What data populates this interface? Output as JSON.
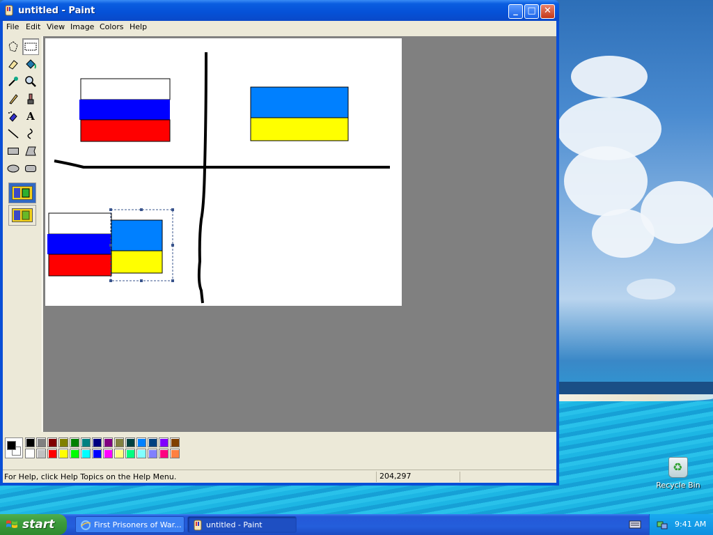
{
  "window": {
    "title": "untitled - Paint",
    "controls": {
      "minimize": "_",
      "maximize": "□",
      "close": "✕"
    }
  },
  "menu": [
    "File",
    "Edit",
    "View",
    "Image",
    "Colors",
    "Help"
  ],
  "tools": [
    {
      "name": "free-form-select-icon"
    },
    {
      "name": "select-icon",
      "active": true
    },
    {
      "name": "eraser-icon"
    },
    {
      "name": "fill-icon"
    },
    {
      "name": "pick-color-icon"
    },
    {
      "name": "magnifier-icon"
    },
    {
      "name": "pencil-icon"
    },
    {
      "name": "brush-icon"
    },
    {
      "name": "airbrush-icon"
    },
    {
      "name": "text-icon",
      "glyph": "A"
    },
    {
      "name": "line-icon"
    },
    {
      "name": "curve-icon"
    },
    {
      "name": "rectangle-icon"
    },
    {
      "name": "polygon-icon"
    },
    {
      "name": "ellipse-icon"
    },
    {
      "name": "rounded-rectangle-icon"
    }
  ],
  "palette": {
    "foreground": "#000000",
    "background": "#ffffff",
    "top_row": [
      "#000000",
      "#808080",
      "#800000",
      "#808000",
      "#008000",
      "#008080",
      "#000080",
      "#800080",
      "#808040",
      "#004040",
      "#0080ff",
      "#004080",
      "#8000ff",
      "#804000"
    ],
    "bottom_row": [
      "#ffffff",
      "#c0c0c0",
      "#ff0000",
      "#ffff00",
      "#00ff00",
      "#00ffff",
      "#0000ff",
      "#ff00ff",
      "#ffff80",
      "#00ff80",
      "#80ffff",
      "#8080ff",
      "#ff0080",
      "#ff8040"
    ]
  },
  "statusbar": {
    "help": "For Help, click Help Topics on the Help Menu.",
    "coords": "204,297"
  },
  "desktop": {
    "recycle_bin": "Recycle Bin"
  },
  "taskbar": {
    "start": "start",
    "tasks": [
      {
        "label": "First Prisoners of War...",
        "icon": "ie-icon"
      },
      {
        "label": "untitled - Paint",
        "icon": "paint-icon",
        "active": true
      }
    ],
    "clock": "9:41 AM"
  },
  "colors": {
    "russia": [
      "#ffffff",
      "#0000ff",
      "#ff0000"
    ],
    "ukraine": [
      "#0080ff",
      "#ffff00"
    ]
  }
}
